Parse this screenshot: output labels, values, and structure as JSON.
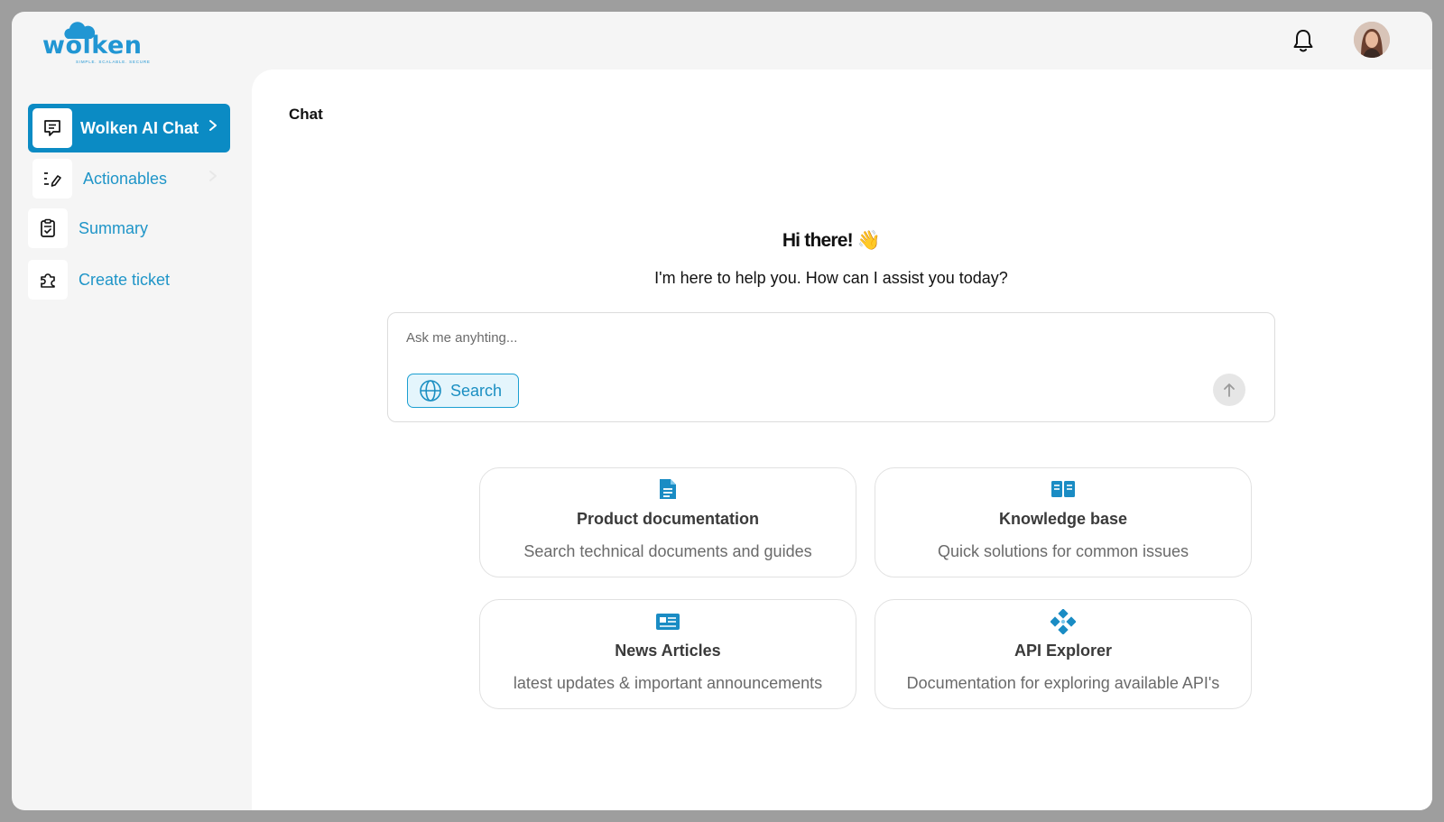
{
  "app": {
    "logo_text": "wolken",
    "logo_tagline": "SIMPLE. SCALABLE. SECURE"
  },
  "colors": {
    "accent": "#0b8bc4",
    "accent_text": "#1f95c8",
    "icon_blue": "#1a8cc4"
  },
  "sidebar": {
    "items": [
      {
        "label": "Wolken AI Chat",
        "icon": "chat-icon",
        "active": true
      },
      {
        "label": "Actionables",
        "icon": "list-edit-icon",
        "active": false
      },
      {
        "label": "Summary",
        "icon": "clipboard-check-icon",
        "active": false
      },
      {
        "label": "Create ticket",
        "icon": "puzzle-icon",
        "active": false
      }
    ]
  },
  "main": {
    "title": "Chat",
    "greeting": "Hi there! 👋",
    "subgreeting": "I'm here to help you. How can I assist you today?",
    "chat": {
      "placeholder": "Ask me anyhting...",
      "value": "",
      "search_label": "Search"
    },
    "cards": [
      {
        "title": "Product documentation",
        "desc": "Search technical documents and guides",
        "icon": "document-icon"
      },
      {
        "title": "Knowledge base",
        "desc": "Quick solutions for common issues",
        "icon": "book-icon"
      },
      {
        "title": "News Articles",
        "desc": "latest updates & important announcements",
        "icon": "newspaper-icon"
      },
      {
        "title": "API Explorer",
        "desc": "Documentation for exploring available API's",
        "icon": "api-icon"
      }
    ]
  }
}
